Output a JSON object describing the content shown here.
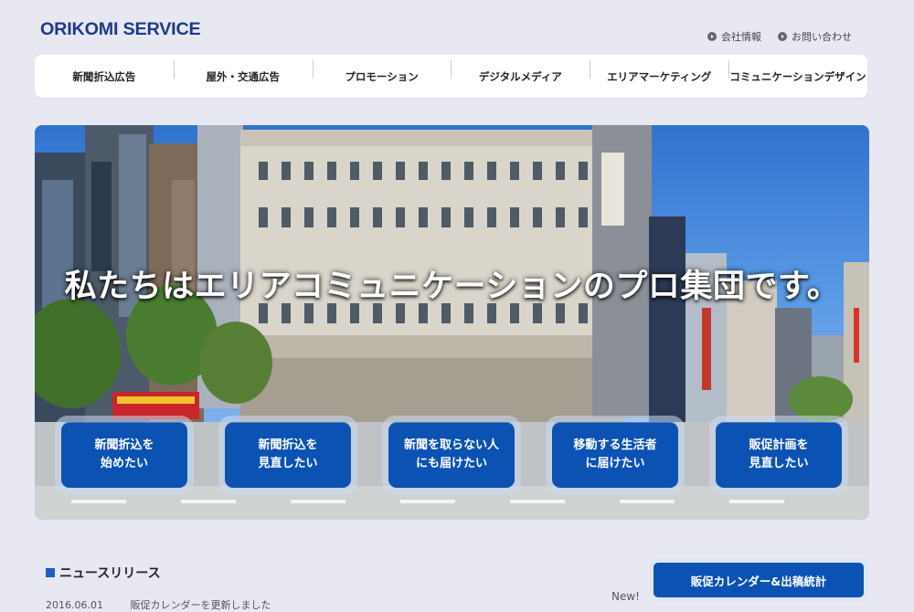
{
  "header": {
    "logo": "ORIKOMI SERVICE",
    "utility_links": [
      {
        "label": "会社情報",
        "icon": "circle-arrow-icon"
      },
      {
        "label": "お問い合わせ",
        "icon": "circle-arrow-icon"
      }
    ]
  },
  "nav": {
    "items": [
      {
        "label": "新聞折込広告"
      },
      {
        "label": "屋外・交通広告"
      },
      {
        "label": "プロモーション"
      },
      {
        "label": "デジタルメディア"
      },
      {
        "label": "エリアマーケティング"
      },
      {
        "label": "コミュニケーションデザイン"
      }
    ]
  },
  "hero": {
    "headline": "私たちはエリアコミュニケーションのプロ集団です。",
    "ctas": [
      {
        "line1": "新聞折込を",
        "line2": "始めたい"
      },
      {
        "line1": "新聞折込を",
        "line2": "見直したい"
      },
      {
        "line1": "新聞を取らない人",
        "line2": "にも届けたい"
      },
      {
        "line1": "移動する生活者",
        "line2": "に届けたい"
      },
      {
        "line1": "販促計画を",
        "line2": "見直したい"
      }
    ]
  },
  "news": {
    "title": "ニュースリリース",
    "new_badge": "New!",
    "items": [
      {
        "date": "2016.06.01",
        "text": "販促カレンダーを更新しました"
      }
    ]
  },
  "sidebar": {
    "calendar_button": "販促カレンダー&出稿統計"
  }
}
